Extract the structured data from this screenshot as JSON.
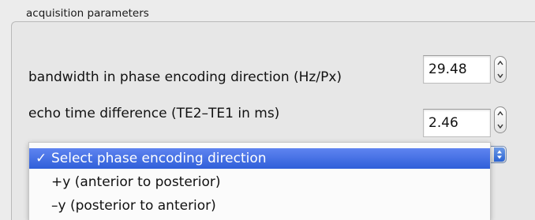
{
  "group": {
    "title": "acquisition parameters"
  },
  "params": [
    {
      "label": "bandwidth in phase encoding direction (Hz/Px)",
      "value": "29.48"
    },
    {
      "label": "echo time difference (TE2–TE1 in ms)",
      "value": "2.46"
    }
  ],
  "phase_direction": {
    "check_mark": "✓",
    "options": [
      {
        "label": "Select phase encoding direction",
        "selected": true
      },
      {
        "label": "+y (anterior to posterior)",
        "selected": false
      },
      {
        "label": "–y (posterior to anterior)",
        "selected": false
      }
    ]
  },
  "colors": {
    "selection": "#2f5fd9",
    "window_bg": "#ececec"
  },
  "icons": {
    "stepper_up": "chevron-up-icon",
    "stepper_down": "chevron-down-icon",
    "combo_arrows": "updown-arrows-icon"
  }
}
